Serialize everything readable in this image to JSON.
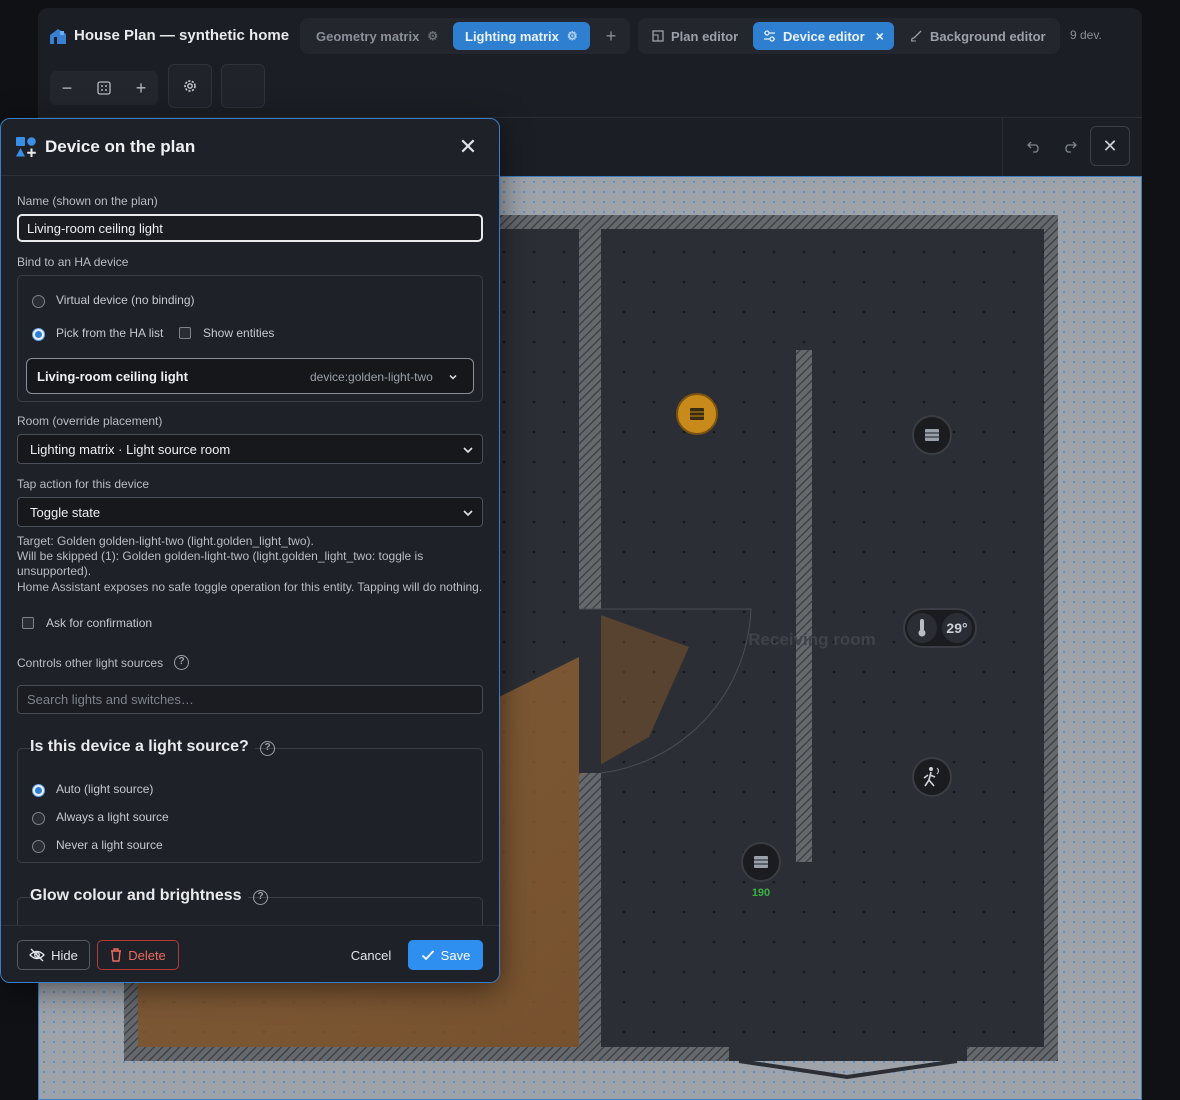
{
  "app": {
    "title": "House Plan — synthetic home",
    "tabs": [
      {
        "label": "Geometry matrix",
        "active": false
      },
      {
        "label": "Lighting matrix",
        "active": true
      }
    ],
    "add_tab_label": "+",
    "modes": [
      {
        "label": "Plan editor",
        "icon": "plan-icon",
        "active": false
      },
      {
        "label": "Device editor",
        "icon": "sliders-icon",
        "active": true
      },
      {
        "label": "Background editor",
        "icon": "brush-icon",
        "active": false
      }
    ],
    "device_count": "9 dev."
  },
  "toolbar": {
    "zoom_out": "−",
    "zoom_fit_icon": "fit-icon",
    "zoom_in": "+",
    "settings_icon": "gear-icon"
  },
  "plan": {
    "room_label": "Receiving room",
    "thermo_value": "29°",
    "light_value": "190",
    "colors": {
      "wall": "#55585d",
      "floor": "#2b2e34",
      "glow": "#a86a2a",
      "active_device": "#c88a1a"
    }
  },
  "modal": {
    "title": "Device on the plan",
    "name_label": "Name (shown on the plan)",
    "name_value": "Living-room ceiling light",
    "bind_label": "Bind to an HA device",
    "bind_options": [
      {
        "label": "Virtual device (no binding)",
        "selected": false
      },
      {
        "label": "Pick from the HA list",
        "selected": true
      }
    ],
    "show_entities_label": "Show entities",
    "device_name": "Living-room ceiling light",
    "device_id": "device:golden-light-two",
    "room_label": "Room (override placement)",
    "room_value": "Lighting matrix · Light source room",
    "tap_label": "Tap action for this device",
    "tap_value": "Toggle state",
    "target_line": "Target: Golden golden-light-two (light.golden_light_two).",
    "skipped_line": "Will be skipped (1): Golden golden-light-two (light.golden_light_two: toggle is unsupported).",
    "warning_line": "Home Assistant exposes no safe toggle operation for this entity. Tapping will do nothing.",
    "confirm_label": "Ask for confirmation",
    "controls_label": "Controls other light sources",
    "search_placeholder": "Search lights and switches…",
    "light_source_title": "Is this device a light source?",
    "light_source_options": [
      {
        "label": "Auto (light source)",
        "selected": true
      },
      {
        "label": "Always a light source",
        "selected": false
      },
      {
        "label": "Never a light source",
        "selected": false
      }
    ],
    "glow_title": "Glow colour and brightness",
    "help_glyph": "?",
    "footer": {
      "hide": "Hide",
      "delete": "Delete",
      "cancel": "Cancel",
      "save": "Save"
    }
  }
}
